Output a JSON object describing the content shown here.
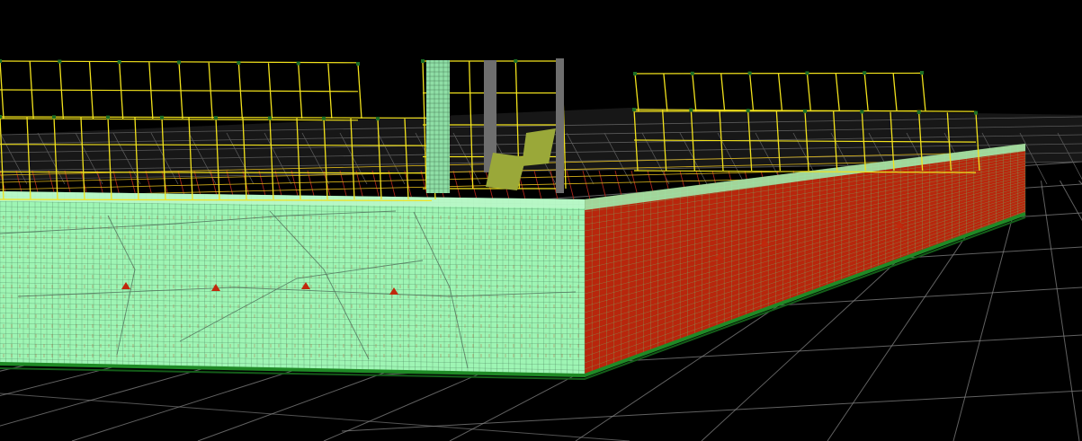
{
  "viewport": {
    "background": "#000000",
    "colors": {
      "ground_grid": "#8a8a8a",
      "far_grid": "#5a5a5a",
      "wall_fill": "#9ef5b4",
      "wall_mesh": "#3f6e4f",
      "wall_mesh_dense": "#2e5a3e",
      "support_marker": "#c0280c",
      "side_wall_fill": "#b8260c",
      "side_wall_mesh": "#5fe08a",
      "base_edge": "#1f8a26",
      "frame": "#f2e21c",
      "frame_node": "#1c6d25",
      "column_fill": "#8fdfa6",
      "column_gray": "#6e6e6e",
      "ramp": "#9aa839",
      "crack_lines": "#4d6b58"
    },
    "icons": [
      "ground-grid",
      "foundation-wall-mesh",
      "steel-frame-left",
      "steel-frame-right",
      "core-column",
      "ramp-slab"
    ]
  }
}
